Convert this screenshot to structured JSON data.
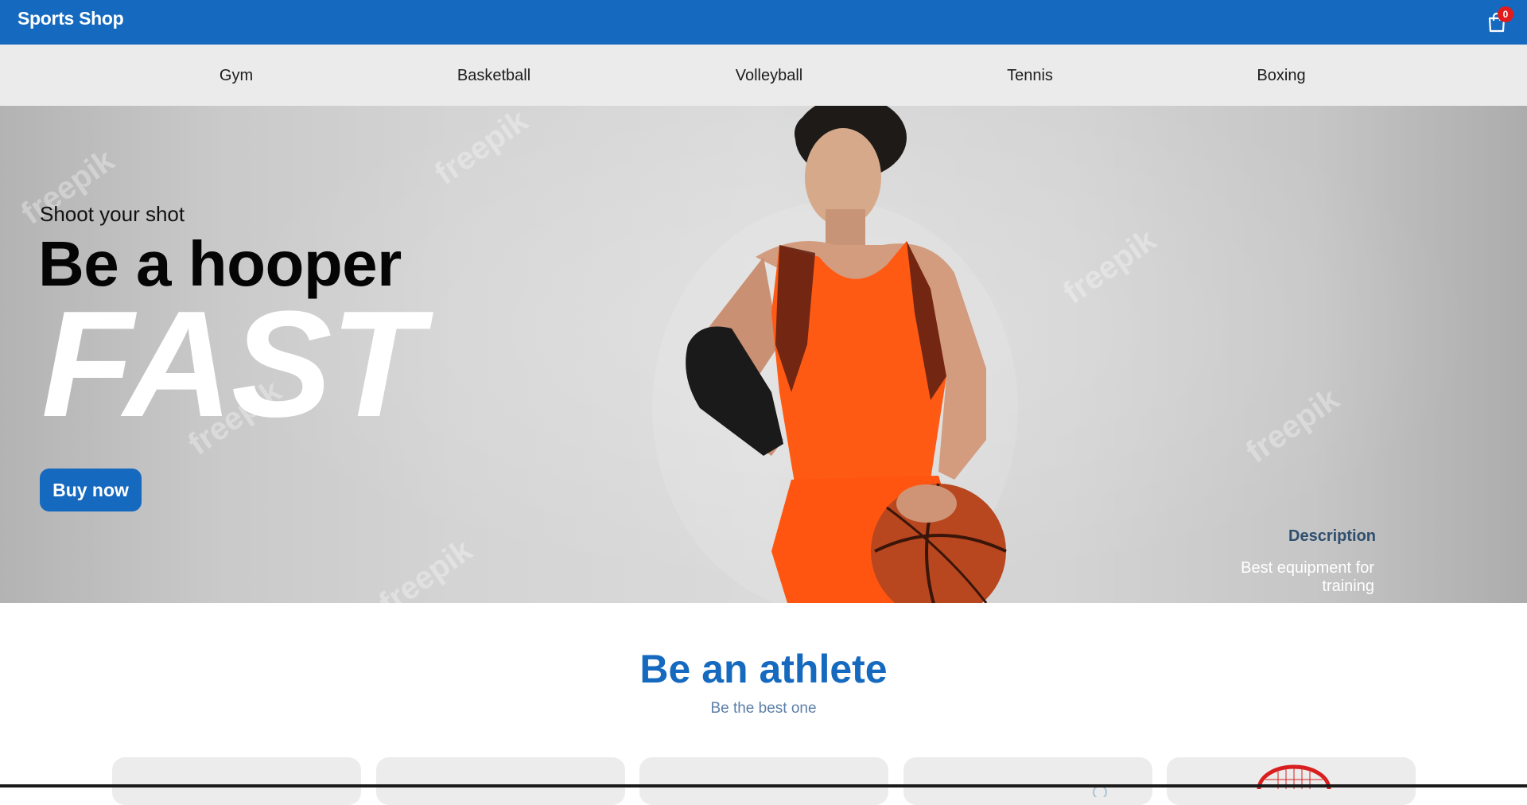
{
  "header": {
    "brand": "Sports Shop",
    "cart_count": "0",
    "cart_icon": "shopping-bag-icon",
    "background": "#1569be"
  },
  "nav": {
    "items": [
      "Gym",
      "Basketball",
      "Volleyball",
      "Tennis",
      "Boxing"
    ]
  },
  "hero": {
    "subtitle": "Shoot your shot",
    "title": "Be a hooper",
    "headline": "FAST",
    "button_label": "Buy now",
    "description_title": "Description",
    "description_text": "Best equipment for training",
    "watermark": "freepik"
  },
  "section": {
    "title": "Be an athlete",
    "subtitle": "Be the best one"
  },
  "colors": {
    "primary": "#1569be",
    "badge": "#e21b1b",
    "jersey": "#ff5a14"
  }
}
